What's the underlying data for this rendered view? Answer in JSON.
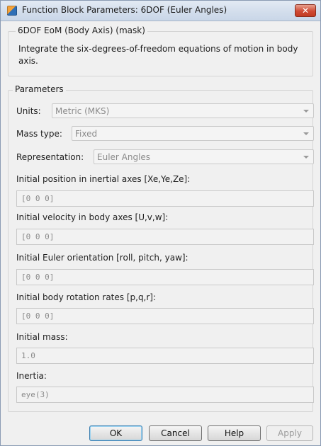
{
  "window": {
    "title": "Function Block Parameters: 6DOF (Euler Angles)",
    "close_glyph": "✕"
  },
  "mask": {
    "title": "6DOF EoM (Body Axis) (mask)",
    "description": "Integrate the six-degrees-of-freedom equations of motion in body axis."
  },
  "parameters": {
    "legend": "Parameters",
    "units": {
      "label": "Units:",
      "value": "Metric (MKS)"
    },
    "mass_type": {
      "label": "Mass type:",
      "value": "Fixed"
    },
    "representation": {
      "label": "Representation:",
      "value": "Euler Angles"
    },
    "fields": [
      {
        "label": "Initial position in inertial axes [Xe,Ye,Ze]:",
        "value": "[0 0 0]"
      },
      {
        "label": "Initial velocity in body axes [U,v,w]:",
        "value": "[0 0 0]"
      },
      {
        "label": "Initial Euler orientation [roll, pitch, yaw]:",
        "value": "[0 0 0]"
      },
      {
        "label": "Initial body rotation rates [p,q,r]:",
        "value": "[0 0 0]"
      },
      {
        "label": "Initial mass:",
        "value": "1.0"
      },
      {
        "label": "Inertia:",
        "value": "eye(3)"
      }
    ]
  },
  "buttons": {
    "ok": "OK",
    "cancel": "Cancel",
    "help": "Help",
    "apply": "Apply"
  }
}
